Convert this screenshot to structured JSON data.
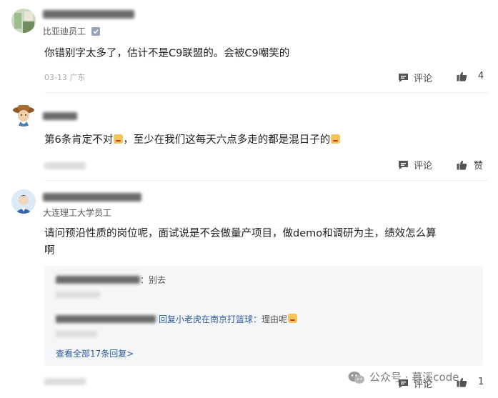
{
  "comments": [
    {
      "badge": "比亚迪员工",
      "text": "你错别字太多了，估计不是C9联盟的。会被C9嘲笑的",
      "date_location": "03-13 广东",
      "comment_label": "评论",
      "like_count": "4",
      "icons": {
        "avatar": "photo-avatar-icon",
        "verified": "verified-badge-icon"
      }
    },
    {
      "text": "第6条肯定不对",
      "text_tail": "，至少在我们这每天六点多走的都是混日子的",
      "comment_label": "评论",
      "like_label": "赞",
      "icons": {
        "avatar": "cowboy-avatar-icon"
      }
    },
    {
      "badge": "大连理工大学员工",
      "text_line1": "请问预沿性质的岗位呢，面试说是不会做量产项目，做demo和调研为主，绩效怎么算",
      "text_line2": "啊",
      "icons": {
        "avatar": "person-avatar-icon"
      }
    }
  ],
  "replies": {
    "first_text": "：别去",
    "second_reply_to": "回复小老虎在南京打篮球",
    "second_text": "：理由呢",
    "view_all": "查看全部17条回复>"
  },
  "bottom": {
    "comment_label": "评论",
    "like_count": "1"
  },
  "watermark": {
    "text": "公众号 · 暮溪code",
    "icon": "wechat-icon"
  }
}
